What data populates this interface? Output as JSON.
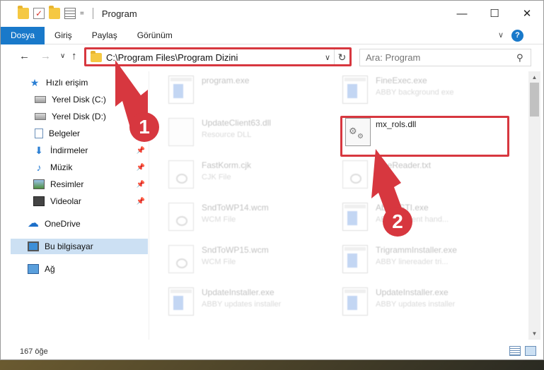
{
  "titlebar": {
    "title": "Program",
    "qat_dropdown": "=",
    "minimize": "—",
    "maximize": "☐",
    "close": "✕"
  },
  "ribbon": {
    "tabs": [
      "Dosya",
      "Giriş",
      "Paylaş",
      "Görünüm"
    ],
    "help": "?",
    "collapse": "∨"
  },
  "nav": {
    "back": "←",
    "forward": "→",
    "recent": "∨",
    "up": "↑"
  },
  "address": {
    "path": "C:\\Program Files\\Program Dizini",
    "dropdown": "∨",
    "refresh": "↻"
  },
  "search": {
    "placeholder": "Ara: Program",
    "icon": "search-icon"
  },
  "sidebar": {
    "items": [
      {
        "label": "Hızlı erişim",
        "icon": "star-icon"
      },
      {
        "label": "Yerel Disk (C:)",
        "icon": "drive-icon",
        "pinned": true
      },
      {
        "label": "Yerel Disk (D:)",
        "icon": "drive-icon"
      },
      {
        "label": "Belgeler",
        "icon": "documents-icon"
      },
      {
        "label": "İndirmeler",
        "icon": "download-icon",
        "pinned": true
      },
      {
        "label": "Müzik",
        "icon": "music-icon",
        "pinned": true
      },
      {
        "label": "Resimler",
        "icon": "pictures-icon",
        "pinned": true
      },
      {
        "label": "Videolar",
        "icon": "videos-icon",
        "pinned": true
      },
      {
        "label": "OneDrive",
        "icon": "cloud-icon"
      },
      {
        "label": "Bu bilgisayar",
        "icon": "computer-icon",
        "selected": true
      },
      {
        "label": "Ağ",
        "icon": "network-icon"
      }
    ]
  },
  "files": [
    {
      "name": "program.exe",
      "desc": "",
      "icon": "exe-icon"
    },
    {
      "name": "FineExec.exe",
      "desc": "ABBY background exe",
      "icon": "exe-icon"
    },
    {
      "name": "UpdateClient63.dll",
      "desc": "Resource DLL",
      "icon": "dll-icon"
    },
    {
      "name": "mx_rols.dll",
      "desc": "",
      "icon": "dll-icon",
      "highlighted": true
    },
    {
      "name": "FastKorm.cjk",
      "desc": "CJK File",
      "icon": "doc-icon"
    },
    {
      "name": "FineReader.txt",
      "desc": "File",
      "icon": "doc-icon"
    },
    {
      "name": "SndToWP14.wcm",
      "desc": "WCM File",
      "icon": "doc-icon"
    },
    {
      "name": "AbbyySTI.exe",
      "desc": "ABBYY event hand...",
      "icon": "exe-icon"
    },
    {
      "name": "SndToWP15.wcm",
      "desc": "WCM File",
      "icon": "doc-icon"
    },
    {
      "name": "TrigrammInstaller.exe",
      "desc": "ABBY linereader tri...",
      "icon": "exe-icon"
    },
    {
      "name": "UpdateInstaller.exe",
      "desc": "ABBY updates installer",
      "icon": "exe-icon"
    },
    {
      "name": "UpdateInstaller.exe",
      "desc": "ABBY updates installer",
      "icon": "exe-icon"
    }
  ],
  "status": {
    "count": "167 öğe"
  },
  "annotations": {
    "badge1": "1",
    "badge2": "2",
    "color": "#d7373f"
  }
}
